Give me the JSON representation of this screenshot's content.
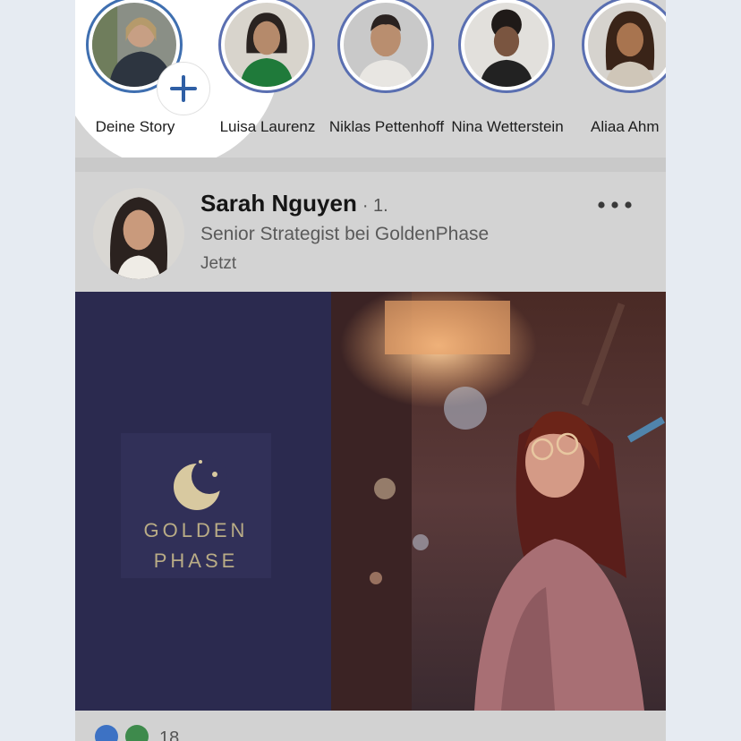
{
  "stories": [
    {
      "name": "Deine Story",
      "own": true
    },
    {
      "name": "Luisa Laurenz",
      "own": false
    },
    {
      "name": "Niklas Pettenhoff",
      "own": false
    },
    {
      "name": "Nina Wetterstein",
      "own": false
    },
    {
      "name": "Aliaa Ahm",
      "own": false
    }
  ],
  "post": {
    "author": "Sarah Nguyen",
    "degree": "· 1.",
    "headline": "Senior Strategist bei GoldenPhase",
    "time": "Jetzt",
    "media": {
      "brand_line1": "GOLDEN",
      "brand_line2": "PHASE"
    },
    "reaction_count": "18"
  },
  "icons": {
    "add_story": "plus-icon",
    "more": "more-options-icon",
    "like": "like-reaction-icon",
    "celebrate": "celebrate-reaction-icon"
  },
  "colors": {
    "accent": "#3f6fb0",
    "brand_navy": "#2b2a4f",
    "brand_gold": "#d8c9a0"
  }
}
